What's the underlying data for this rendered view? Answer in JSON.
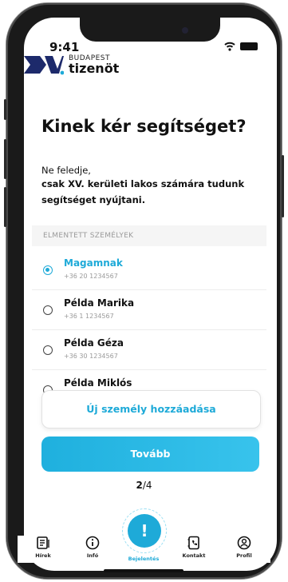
{
  "status_bar": {
    "time": "9:41"
  },
  "brand": {
    "top": "BUDAPEST",
    "bottom": "tizenöt",
    "mark_text": "XV."
  },
  "page": {
    "title": "Kinek kér segítséget?",
    "reminder_line1": "Ne feledje,",
    "reminder_line2": "csak XV. kerületi lakos számára tudunk segítséget nyújtani."
  },
  "saved_people": {
    "header": "ELMENTETT SZEMÉLYEK",
    "items": [
      {
        "name": "Magamnak",
        "phone": "+36 20 1234567",
        "selected": true
      },
      {
        "name": "Példa Marika",
        "phone": "+36 1 1234567",
        "selected": false
      },
      {
        "name": "Példa Géza",
        "phone": "+36 30 1234567",
        "selected": false
      },
      {
        "name": "Példa Miklós",
        "phone": "",
        "selected": false
      }
    ]
  },
  "actions": {
    "add_person": "Új személy hozzáadása",
    "next": "Tovább"
  },
  "progress": {
    "current": "2",
    "total": "/4"
  },
  "tabbar": {
    "items": [
      {
        "label": "Hírek",
        "icon": "news-icon"
      },
      {
        "label": "Infó",
        "icon": "info-icon"
      },
      {
        "label": "Bejelentés",
        "icon": "exclamation-icon",
        "active": true
      },
      {
        "label": "Kontakt",
        "icon": "phone-book-icon"
      },
      {
        "label": "Profil",
        "icon": "profile-icon"
      }
    ],
    "fab_glyph": "!"
  },
  "colors": {
    "accent": "#1eaad8",
    "text": "#111111",
    "muted": "#9a9a9a"
  }
}
